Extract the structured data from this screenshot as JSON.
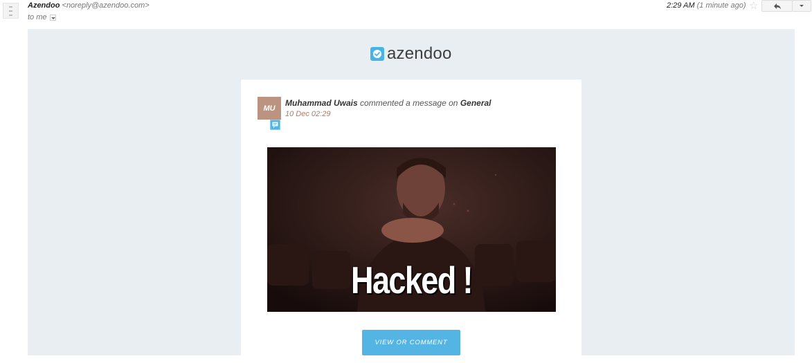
{
  "header": {
    "sender_name": "Azendoo",
    "sender_email": "<noreply@azendoo.com>",
    "recipient": "to me",
    "time": "2:29 AM",
    "time_relative": "(1 minute ago)"
  },
  "brand": {
    "name": "azendoo",
    "color": "#47b4e6"
  },
  "notification": {
    "avatar_initials": "MU",
    "user_name": "Muhammad Uwais",
    "action_text": "commented a message on",
    "workspace": "General",
    "timestamp": "10 Dec 02:29"
  },
  "attachment": {
    "caption": "Hacked !"
  },
  "cta": {
    "label": "VIEW OR COMMENT",
    "color": "#54b5e5"
  },
  "icons": [
    "star-icon",
    "reply-icon",
    "chevron-down-icon",
    "check-icon",
    "comment-icon"
  ]
}
